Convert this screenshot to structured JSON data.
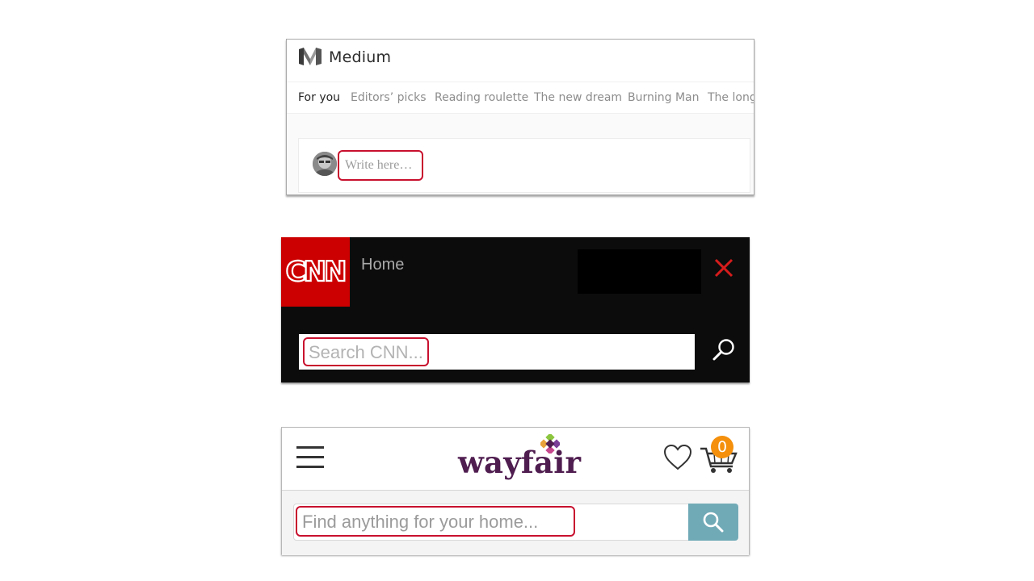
{
  "medium": {
    "brand": "Medium",
    "tabs": [
      {
        "label": "For you",
        "active": true
      },
      {
        "label": "Editors’ picks",
        "active": false
      },
      {
        "label": "Reading roulette",
        "active": false
      },
      {
        "label": "The new dream",
        "active": false
      },
      {
        "label": "Burning Man",
        "active": false
      },
      {
        "label": "The long",
        "active": false
      }
    ],
    "compose_placeholder": "Write here…",
    "logo_icon": "medium-m-icon",
    "avatar_icon": "user-avatar"
  },
  "cnn": {
    "logo_text": "CNN",
    "nav_label": "Home",
    "search_placeholder": "Search CNN...",
    "brand_color": "#cc0000",
    "close_icon": "close-icon",
    "search_icon": "search-icon"
  },
  "wayfair": {
    "logo_text": "wayfair",
    "search_placeholder": "Find anything for your home...",
    "cart_count": "0",
    "brand_color": "#4f1d4f",
    "search_button_color": "#71aab7",
    "badge_color": "#f4900c",
    "icons": [
      "menu-icon",
      "heart-icon",
      "cart-icon",
      "search-icon"
    ]
  },
  "highlight_color": "#c8102e"
}
